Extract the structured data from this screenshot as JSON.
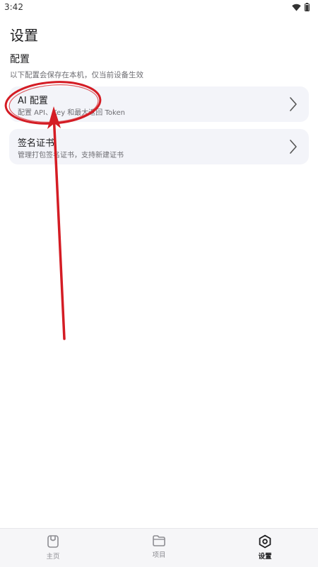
{
  "status_bar": {
    "time": "3:42",
    "icons": [
      "wifi-icon",
      "battery-icon"
    ]
  },
  "header": {
    "title": "设置"
  },
  "section": {
    "title": "配置",
    "description": "以下配置会保存在本机，仅当前设备生效"
  },
  "settings_items": [
    {
      "title": "AI 配置",
      "subtitle": "配置 API、Key 和最大返回 Token",
      "icon": "chevron-right-icon"
    },
    {
      "title": "签名证书",
      "subtitle": "管理打包签名证书，支持新建证书",
      "icon": "chevron-right-icon"
    }
  ],
  "bottom_nav": {
    "items": [
      {
        "label": "主页",
        "icon": "home-icon",
        "active": false
      },
      {
        "label": "项目",
        "icon": "folder-icon",
        "active": false
      },
      {
        "label": "设置",
        "icon": "settings-icon",
        "active": true
      }
    ]
  },
  "colors": {
    "background": "#ffffff",
    "card_background": "#f3f4f9",
    "annotation_red": "#d41c24",
    "active_nav": "#1c1c1e",
    "inactive_nav": "#8e8e93"
  }
}
